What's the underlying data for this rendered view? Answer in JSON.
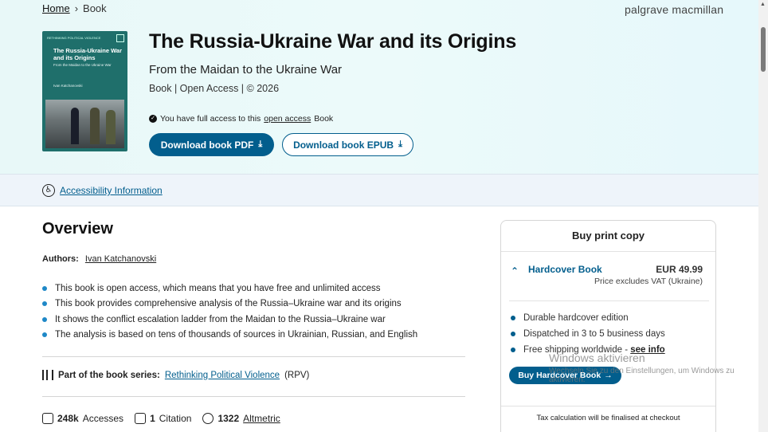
{
  "breadcrumb": {
    "home": "Home",
    "separator": "›",
    "current": "Book"
  },
  "publisher": "palgrave macmillan",
  "cover": {
    "series": "RETHINKING POLITICAL VIOLENCE",
    "title": "The Russia-Ukraine War and its Origins",
    "subtitle": "From the Maidan to the Ukraine War",
    "author": "Ivan Katchanovski"
  },
  "book": {
    "title": "The Russia-Ukraine War and its Origins",
    "subtitle": "From the Maidan to the Ukraine War",
    "meta": "Book | Open Access | © 2026",
    "access_prefix": "You have full access to this",
    "access_link": "open access",
    "access_suffix": "Book"
  },
  "buttons": {
    "pdf": "Download book PDF",
    "epub": "Download book EPUB",
    "download_icon": "⤓"
  },
  "accessibility": {
    "link": "Accessibility Information"
  },
  "overview": {
    "heading": "Overview",
    "authors_label": "Authors:",
    "author": "Ivan Katchanovski",
    "bullets": [
      "This book is open access, which means that you have free and unlimited access",
      "This book provides comprehensive analysis of the Russia–Ukraine war and its origins",
      "It shows the conflict escalation ladder from the Maidan to the Russia–Ukraine war",
      "The analysis is based on tens of thousands of sources in Ukrainian, Russian, and English"
    ],
    "series_label": "Part of the book series:",
    "series_link": "Rethinking Political Violence",
    "series_abbr": "(RPV)"
  },
  "metrics": {
    "accesses_value": "248k",
    "accesses_label": "Accesses",
    "citations_value": "1",
    "citations_label": "Citation",
    "altmetric_value": "1322",
    "altmetric_label": "Altmetric"
  },
  "buy": {
    "title": "Buy print copy",
    "format": "Hardcover Book",
    "price": "EUR 49.99",
    "vat": "Price excludes VAT (Ukraine)",
    "features": [
      "Durable hardcover edition",
      "Dispatched in 3 to 5 business days",
      "Free shipping worldwide - "
    ],
    "see_info": "see info",
    "button": "Buy Hardcover Book",
    "button_arrow": "→",
    "tax_note": "Tax calculation will be finalised at checkout"
  },
  "watermark": {
    "line1": "Windows aktivieren",
    "line2": "Wechseln Sie zu den Einstellungen, um Windows zu aktivieren."
  },
  "colors": {
    "accent": "#025e8d",
    "bullet": "#1e88c7",
    "hero_bg": "#e8f8f8"
  }
}
